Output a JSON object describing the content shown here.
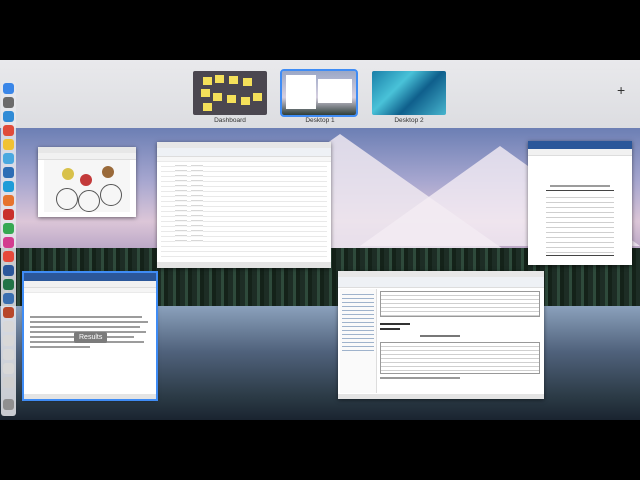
{
  "mission_control": {
    "spaces": [
      {
        "label": "Dashboard"
      },
      {
        "label": "Desktop 1"
      },
      {
        "label": "Desktop 2"
      }
    ],
    "add_space_symbol": "+"
  },
  "windows": {
    "word_results": {
      "hover_label": "Results"
    }
  },
  "colors": {
    "selection": "#3f8cf5",
    "word_blue": "#2b579a"
  }
}
